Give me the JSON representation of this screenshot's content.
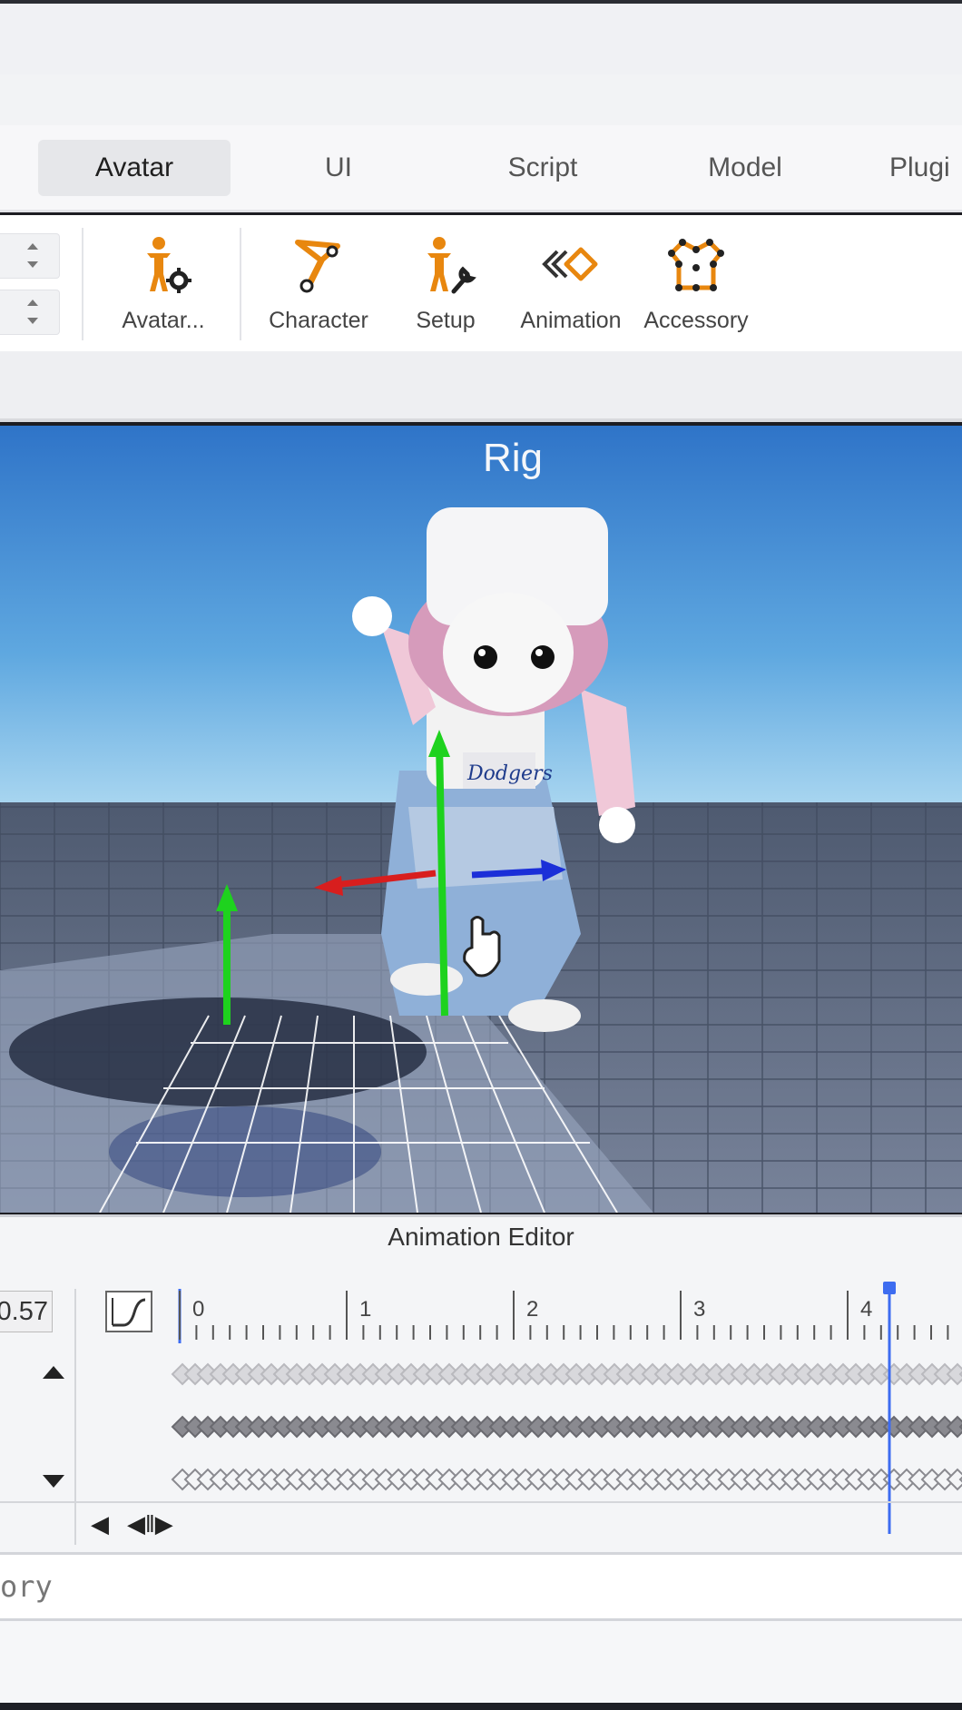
{
  "tabs": [
    {
      "label": "Avatar",
      "active": true
    },
    {
      "label": "UI",
      "active": false
    },
    {
      "label": "Script",
      "active": false
    },
    {
      "label": "Model",
      "active": false
    },
    {
      "label": "Plugi",
      "active": false
    }
  ],
  "ribbon": {
    "tools": [
      {
        "label": "Avatar...",
        "icon": "avatar-settings-icon"
      },
      {
        "label": "Character",
        "icon": "character-icon"
      },
      {
        "label": "Setup",
        "icon": "setup-icon"
      },
      {
        "label": "Animation",
        "icon": "animation-icon"
      },
      {
        "label": "Accessory",
        "icon": "accessory-icon"
      }
    ],
    "accent_color": "#e8870f"
  },
  "viewport": {
    "model_name": "Rig"
  },
  "animation_editor": {
    "title": "Animation Editor",
    "time_value": "0.57",
    "ruler_labels": [
      "0",
      "1",
      "2",
      "3",
      "4"
    ],
    "playhead_color": "#3d6cf0"
  },
  "history": {
    "text": "ory"
  }
}
